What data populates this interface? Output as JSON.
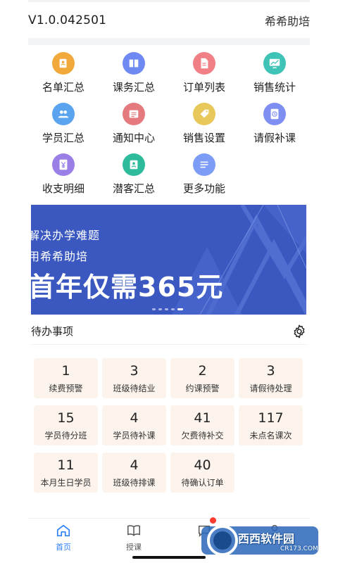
{
  "header": {
    "version": "V1.0.042501",
    "app_name": "希希助培"
  },
  "colors": {
    "accent": "#2d7ff9",
    "banner_bg": "#3a58c0",
    "card_bg": "#fbf3ec"
  },
  "menu": [
    {
      "label": "名单汇总",
      "icon": "contact-book-icon",
      "color": "#f0a93a"
    },
    {
      "label": "课务汇总",
      "icon": "book-icon",
      "color": "#6e89f2"
    },
    {
      "label": "订单列表",
      "icon": "document-icon",
      "color": "#f07f86"
    },
    {
      "label": "销售统计",
      "icon": "chart-board-icon",
      "color": "#3fc3b6"
    },
    {
      "label": "学员汇总",
      "icon": "students-icon",
      "color": "#5aa4ef"
    },
    {
      "label": "通知中心",
      "icon": "notice-icon",
      "color": "#e47a7e"
    },
    {
      "label": "销售设置",
      "icon": "tag-icon",
      "color": "#e8c85a"
    },
    {
      "label": "请假补课",
      "icon": "clock-icon",
      "color": "#7f8ff1"
    },
    {
      "label": "收支明细",
      "icon": "yuan-icon",
      "color": "#9a80e6"
    },
    {
      "label": "潜客汇总",
      "icon": "contact-card-icon",
      "color": "#2dbb9b"
    },
    {
      "label": "更多功能",
      "icon": "more-lines-icon",
      "color": "#7d9cf5"
    }
  ],
  "banner": {
    "line1": "解决办学难题",
    "line2": "用希希助培",
    "line3": "首年仅需365元",
    "slide_count": 5,
    "active_slide": 4
  },
  "todo": {
    "title": "待办事项",
    "items": [
      {
        "count": "1",
        "label": "续费预警"
      },
      {
        "count": "3",
        "label": "班级待结业"
      },
      {
        "count": "2",
        "label": "约课预警"
      },
      {
        "count": "3",
        "label": "请假待处理"
      },
      {
        "count": "15",
        "label": "学员待分班"
      },
      {
        "count": "4",
        "label": "学员待补课"
      },
      {
        "count": "41",
        "label": "欠费待补交"
      },
      {
        "count": "117",
        "label": "未点名课次"
      },
      {
        "count": "11",
        "label": "本月生日学员"
      },
      {
        "count": "4",
        "label": "班级待排课"
      },
      {
        "count": "40",
        "label": "待确认订单"
      }
    ]
  },
  "tabs": [
    {
      "label": "首页",
      "icon": "home-icon",
      "active": true
    },
    {
      "label": "授课",
      "icon": "open-book-icon"
    },
    {
      "label": "",
      "icon": "chat-icon",
      "badge": true
    },
    {
      "label": "",
      "icon": "person-icon"
    }
  ],
  "watermark": {
    "text": "西西软件园",
    "sub": "CR173.COM"
  }
}
